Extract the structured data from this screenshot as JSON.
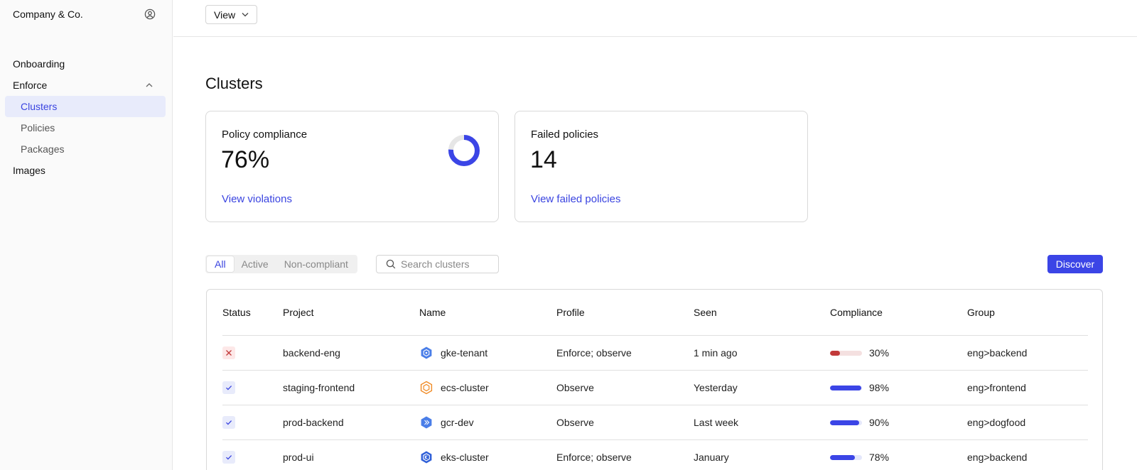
{
  "sidebar": {
    "brand": "Company & Co.",
    "items": [
      {
        "label": "Onboarding"
      },
      {
        "label": "Enforce"
      },
      {
        "label": "Clusters"
      },
      {
        "label": "Policies"
      },
      {
        "label": "Packages"
      },
      {
        "label": "Images"
      }
    ]
  },
  "topbar": {
    "view_label": "View"
  },
  "page": {
    "title": "Clusters"
  },
  "cards": [
    {
      "label": "Policy compliance",
      "value": "76%",
      "link": "View violations",
      "donut_fraction": 0.76
    },
    {
      "label": "Failed policies",
      "value": "14",
      "link": "View failed policies"
    }
  ],
  "filters": {
    "tabs": [
      {
        "label": "All"
      },
      {
        "label": "Active"
      },
      {
        "label": "Non-compliant"
      }
    ],
    "search_placeholder": "Search clusters",
    "discover_label": "Discover"
  },
  "table": {
    "headers": [
      "Status",
      "Project",
      "Name",
      "Profile",
      "Seen",
      "Compliance",
      "Group"
    ],
    "rows": [
      {
        "status": "fail",
        "project": "backend-eng",
        "icon": "gke-icon",
        "name": "gke-tenant",
        "profile": "Enforce; observe",
        "seen": "1 min ago",
        "compliance": "30%",
        "compliance_value": 0.3,
        "group": "eng>backend"
      },
      {
        "status": "ok",
        "project": "staging-frontend",
        "icon": "ecs-icon",
        "name": "ecs-cluster",
        "profile": "Observe",
        "seen": "Yesterday",
        "compliance": "98%",
        "compliance_value": 0.98,
        "group": "eng>frontend"
      },
      {
        "status": "ok",
        "project": "prod-backend",
        "icon": "gcr-icon",
        "name": "gcr-dev",
        "profile": "Observe",
        "seen": "Last week",
        "compliance": "90%",
        "compliance_value": 0.9,
        "group": "eng>dogfood"
      },
      {
        "status": "ok",
        "project": "prod-ui",
        "icon": "eks-icon",
        "name": "eks-cluster",
        "profile": "Enforce; observe",
        "seen": "January",
        "compliance": "78%",
        "compliance_value": 0.78,
        "group": "eng>backend"
      }
    ]
  },
  "colors": {
    "accent": "#3b45e6",
    "danger": "#c23a3a",
    "active_bg": "#e8ebfb"
  }
}
